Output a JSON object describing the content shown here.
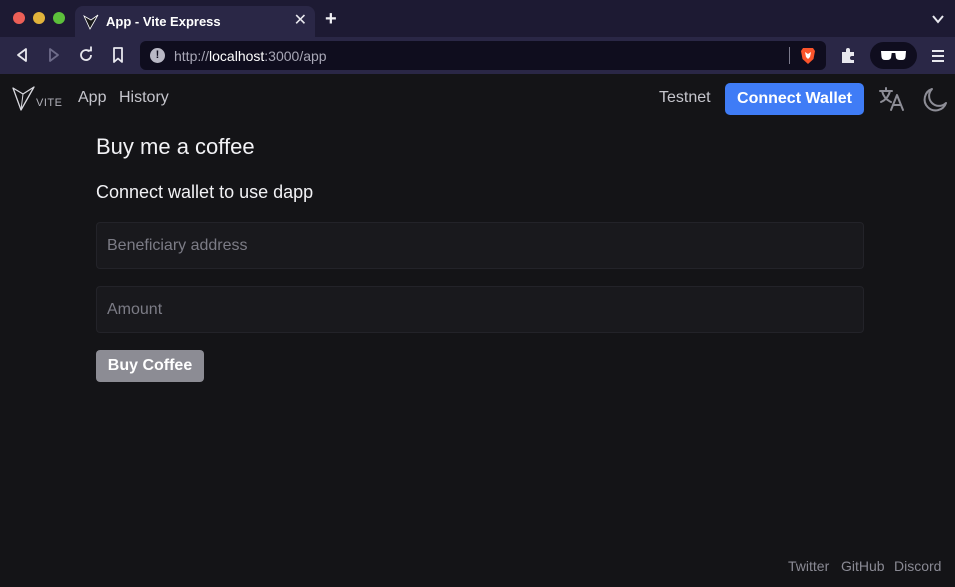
{
  "browser": {
    "tab_title": "App - Vite Express",
    "tab_close": "✕",
    "new_tab": "+",
    "url_scheme": "http://",
    "url_host": "localhost",
    "url_rest": ":3000/app",
    "info_glyph": "!"
  },
  "navbar": {
    "links": [
      {
        "label": "App"
      },
      {
        "label": "History"
      }
    ],
    "network": "Testnet",
    "connect_label": "Connect Wallet"
  },
  "main": {
    "title": "Buy me a coffee",
    "subtitle": "Connect wallet to use dapp",
    "beneficiary_placeholder": "Beneficiary address",
    "amount_placeholder": "Amount",
    "buy_label": "Buy Coffee"
  },
  "footer": {
    "links": [
      "Twitter",
      "GitHub",
      "Discord"
    ]
  },
  "colors": {
    "accent": "#3f7cf6",
    "background": "#141417",
    "chrome": "#2a2746",
    "disabled_button": "#8c8c94"
  },
  "icons": [
    "back-icon",
    "forward-icon",
    "reload-icon",
    "bookmark-icon",
    "info-icon",
    "brave-shield-icon",
    "extensions-icon",
    "profile-glasses-icon",
    "menu-icon",
    "vite-logo",
    "translate-icon",
    "moon-icon"
  ]
}
